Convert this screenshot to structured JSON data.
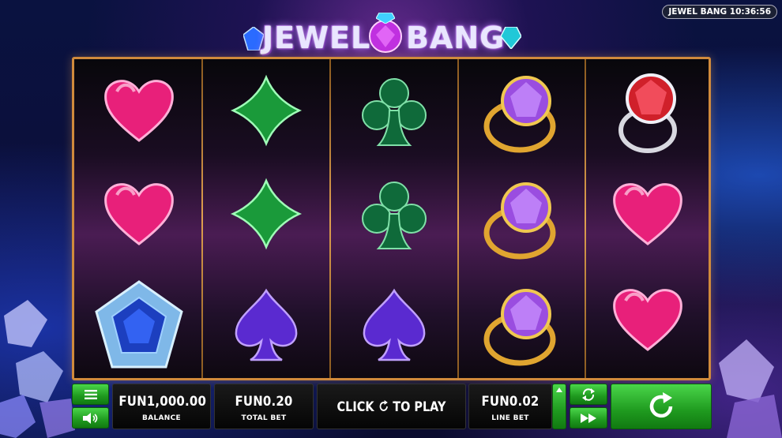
{
  "game": {
    "clock": "JEWEL BANG 10:36:56",
    "logo_left": "JEWEL",
    "logo_right": "BANG"
  },
  "reels": [
    [
      "heart-icon",
      "heart-icon",
      "sapphire-brooch-icon"
    ],
    [
      "diamond-suit-icon",
      "diamond-suit-icon",
      "spade-icon"
    ],
    [
      "club-icon",
      "club-icon",
      "spade-icon"
    ],
    [
      "amethyst-ring-icon",
      "amethyst-ring-icon",
      "amethyst-ring-icon"
    ],
    [
      "ruby-ring-icon",
      "heart-icon",
      "heart-icon"
    ]
  ],
  "controls": {
    "balance_value": "FUN1,000.00",
    "balance_label": "BALANCE",
    "total_bet_value": "FUN0.20",
    "total_bet_label": "TOTAL BET",
    "play_prefix": "CLICK",
    "play_suffix": "TO PLAY",
    "line_bet_value": "FUN0.02",
    "line_bet_label": "LINE BET",
    "menu_icon": "menu-icon",
    "sound_icon": "speaker-icon",
    "autoplay_icon": "autoplay-icon",
    "turbo_icon": "fast-forward-icon",
    "spin_icon": "spin-icon"
  },
  "colors": {
    "frame": "#d08a3c",
    "button_green": "#1f9a1f",
    "heart": "#e8207a",
    "diamond": "#1a9a3a",
    "club": "#0f6a3a",
    "spade": "#5a2ad0"
  }
}
